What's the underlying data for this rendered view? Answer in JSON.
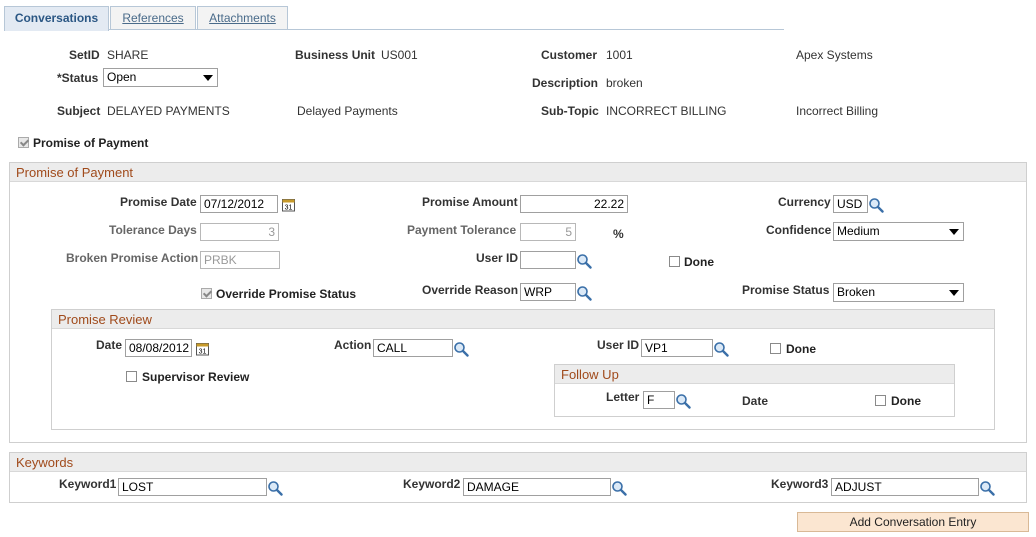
{
  "tabs": [
    {
      "label": "Conversations"
    },
    {
      "label": "References"
    },
    {
      "label": "Attachments"
    }
  ],
  "header": {
    "setid_label": "SetID",
    "setid_value": "SHARE",
    "business_unit_label": "Business Unit",
    "business_unit_value": "US001",
    "customer_label": "Customer",
    "customer_value": "1001",
    "customer_name": "Apex Systems",
    "status_label": "*Status",
    "status_value": "Open",
    "description_label": "Description",
    "description_value": "broken",
    "subject_label": "Subject",
    "subject_value": "DELAYED PAYMENTS",
    "subject_desc": "Delayed Payments",
    "subtopic_label": "Sub-Topic",
    "subtopic_value": "INCORRECT BILLING",
    "subtopic_desc": "Incorrect Billing",
    "promise_checkbox_label": "Promise of Payment"
  },
  "promise": {
    "title": "Promise of Payment",
    "promise_date_label": "Promise Date",
    "promise_date_value": "07/12/2012",
    "promise_amount_label": "Promise Amount",
    "promise_amount_value": "22.22",
    "currency_label": "Currency",
    "currency_value": "USD",
    "tolerance_days_label": "Tolerance Days",
    "tolerance_days_value": "3",
    "payment_tolerance_label": "Payment Tolerance",
    "payment_tolerance_value": "5",
    "percent_sign": "%",
    "confidence_label": "Confidence",
    "confidence_value": "Medium",
    "broken_action_label": "Broken Promise Action",
    "broken_action_value": "PRBK",
    "user_id_label": "User ID",
    "user_id_value": "",
    "done_label": "Done",
    "override_status_label": "Override Promise Status",
    "override_reason_label": "Override Reason",
    "override_reason_value": "WRP",
    "promise_status_label": "Promise Status",
    "promise_status_value": "Broken"
  },
  "review": {
    "title": "Promise Review",
    "date_label": "Date",
    "date_value": "08/08/2012",
    "action_label": "Action",
    "action_value": "CALL",
    "user_id_label": "User ID",
    "user_id_value": "VP1",
    "done_label": "Done",
    "supervisor_label": "Supervisor Review"
  },
  "followup": {
    "title": "Follow Up",
    "letter_label": "Letter",
    "letter_value": "F",
    "date_label": "Date",
    "done_label": "Done"
  },
  "keywords": {
    "title": "Keywords",
    "k1_label": "Keyword1",
    "k1_value": "LOST",
    "k2_label": "Keyword2",
    "k2_value": "DAMAGE",
    "k3_label": "Keyword3",
    "k3_value": "ADJUST"
  },
  "actions": {
    "add_entry_label": "Add Conversation Entry"
  }
}
